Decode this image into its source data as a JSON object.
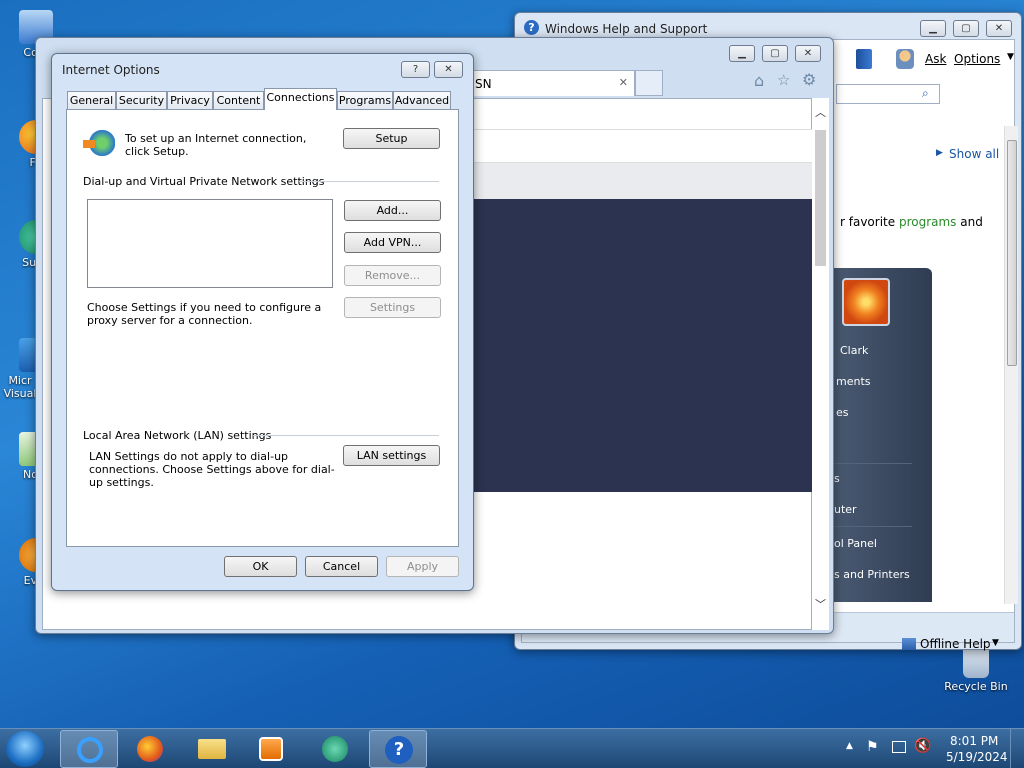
{
  "desktop": {
    "icons": [
      {
        "label": "Com"
      },
      {
        "label": "Fir"
      },
      {
        "label": "Supe"
      },
      {
        "label": "Micr Visual"
      },
      {
        "label": "Note"
      },
      {
        "label": "Ever"
      }
    ],
    "recycle_bin": "Recycle Bin"
  },
  "help_window": {
    "title": "Windows Help and Support",
    "ask": "Ask",
    "options": "Options",
    "show_all": "Show all",
    "body_prefix": "r favorite ",
    "body_link": "programs",
    "body_suffix": " and",
    "offline_help": "Offline Help",
    "menu_items": [
      "Clark",
      "ments",
      "es",
      "s",
      "uter",
      "ol Panel",
      "s and Printers"
    ]
  },
  "ie_window": {
    "tab_label": "SN"
  },
  "dialog": {
    "title": "Internet Options",
    "help_btn": "?",
    "close_btn": "✕",
    "tabs": [
      "General",
      "Security",
      "Privacy",
      "Content",
      "Connections",
      "Programs",
      "Advanced"
    ],
    "setup_text": "To set up an Internet connection, click Setup.",
    "setup_button": "Setup",
    "vpn_group": "Dial-up and Virtual Private Network settings",
    "add_button": "Add...",
    "add_vpn_button": "Add VPN...",
    "remove_button": "Remove...",
    "settings_button": "Settings",
    "proxy_text": "Choose Settings if you need to configure a proxy server for a connection.",
    "lan_group": "Local Area Network (LAN) settings",
    "lan_text": "LAN Settings do not apply to dial-up connections. Choose Settings above for dial-up settings.",
    "lan_button": "LAN settings",
    "ok": "OK",
    "cancel": "Cancel",
    "apply": "Apply"
  },
  "taskbar": {
    "time": "8:01 PM",
    "date": "5/19/2024"
  },
  "colors": {
    "link_green": "#2a8a2a",
    "link_blue": "#1a56a6",
    "dark_panel": "#2b3350"
  }
}
